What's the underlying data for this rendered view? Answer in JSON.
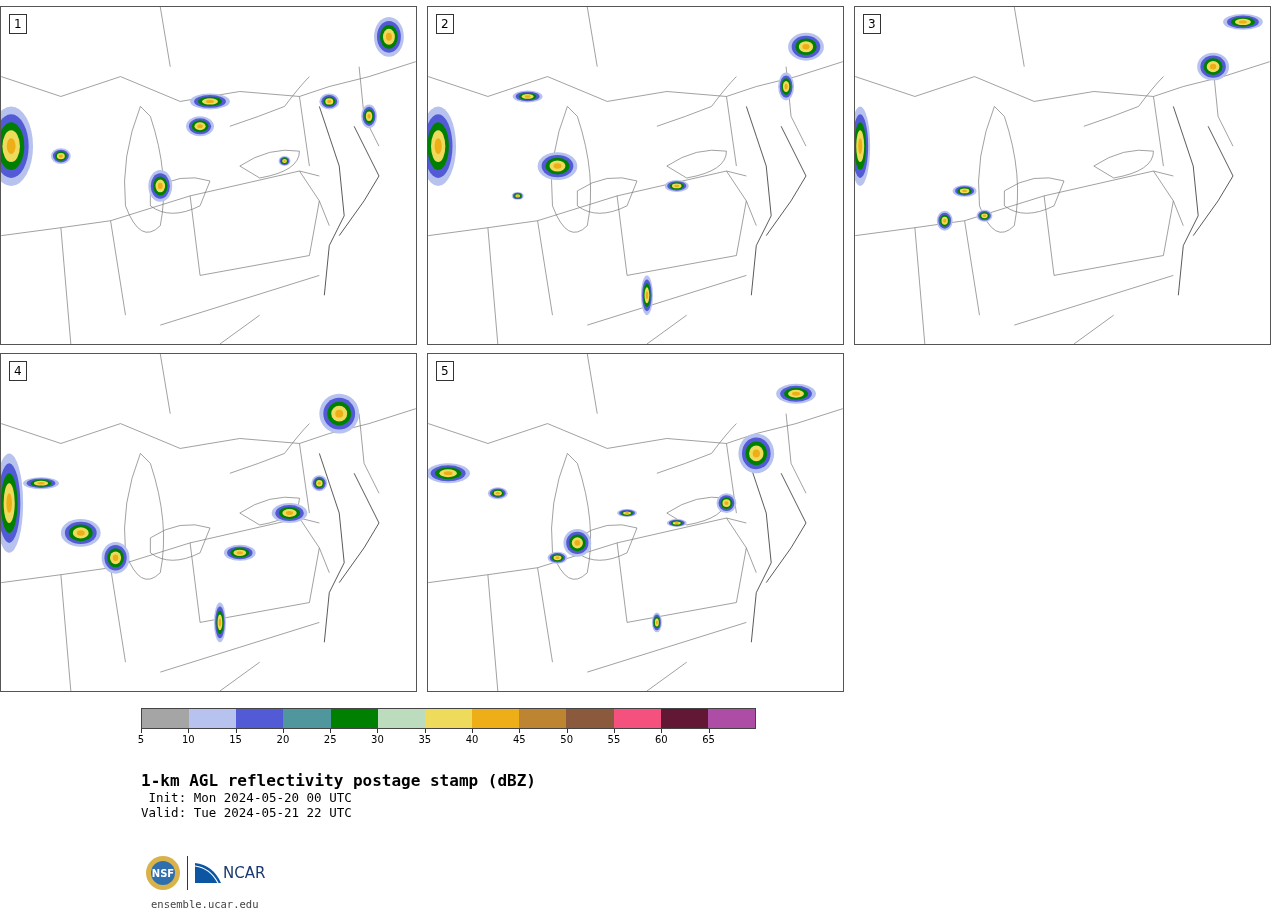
{
  "panels": [
    {
      "label": "1"
    },
    {
      "label": "2"
    },
    {
      "label": "3"
    },
    {
      "label": "4"
    },
    {
      "label": "5"
    }
  ],
  "colorbar": {
    "bins": [
      {
        "color": "#a5a5a5"
      },
      {
        "color": "#b7c2ee"
      },
      {
        "color": "#525ad6"
      },
      {
        "color": "#4f979c"
      },
      {
        "color": "#008000"
      },
      {
        "color": "#bddcbd"
      },
      {
        "color": "#eedb5b"
      },
      {
        "color": "#eeae17"
      },
      {
        "color": "#bd8431"
      },
      {
        "color": "#8b5a3c"
      },
      {
        "color": "#f4517f"
      },
      {
        "color": "#621735"
      },
      {
        "color": "#ae4da6"
      }
    ],
    "ticks": [
      "5",
      "10",
      "15",
      "20",
      "25",
      "30",
      "35",
      "40",
      "45",
      "50",
      "55",
      "60",
      "65"
    ]
  },
  "title": "1-km AGL reflectivity postage stamp (dBZ)",
  "init": " Init: Mon 2024-05-20 00 UTC",
  "valid": "Valid: Tue 2024-05-21 22 UTC",
  "logo": {
    "seal": "NSF",
    "wordmark": "NCAR"
  },
  "site": "ensemble.ucar.edu"
}
